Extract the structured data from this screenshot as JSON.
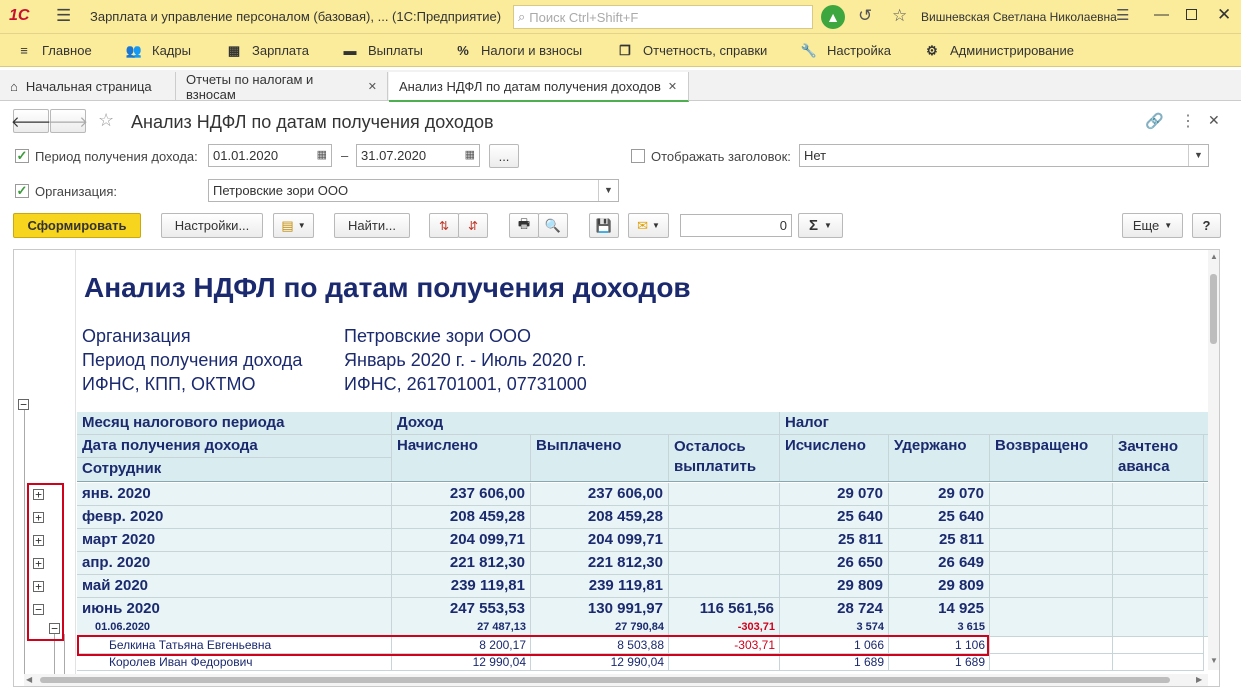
{
  "app": {
    "logo": "1С",
    "title": "Зарплата и управление персоналом (базовая), ...  (1С:Предприятие)",
    "search_placeholder": "Поиск Ctrl+Shift+F",
    "user": "Вишневская Светлана Николаевна"
  },
  "menu": [
    {
      "icon": "hamburger-icon",
      "label": "Главное"
    },
    {
      "icon": "people-icon",
      "label": "Кадры"
    },
    {
      "icon": "calculator-icon",
      "label": "Зарплата"
    },
    {
      "icon": "wallet-icon",
      "label": "Выплаты"
    },
    {
      "icon": "percent-icon",
      "label": "Налоги и взносы"
    },
    {
      "icon": "report-icon",
      "label": "Отчетность, справки"
    },
    {
      "icon": "wrench-icon",
      "label": "Настройка"
    },
    {
      "icon": "gear-icon",
      "label": "Администрирование"
    }
  ],
  "tabs": [
    {
      "label": "Начальная страница"
    },
    {
      "label": "Отчеты по налогам и взносам"
    },
    {
      "label": "Анализ НДФЛ по датам получения доходов"
    }
  ],
  "form": {
    "title": "Анализ НДФЛ по датам получения доходов",
    "period_label": "Период получения дохода:",
    "date_from": "01.01.2020",
    "date_dash": "–",
    "date_to": "31.07.2020",
    "ellipsis": "...",
    "show_header_label": "Отображать заголовок:",
    "show_header_value": "Нет",
    "org_label": "Организация:",
    "org_value": "Петровские зори ООО",
    "generate_btn": "Сформировать",
    "settings_btn": "Настройки...",
    "find_btn": "Найти...",
    "sum_value": "0",
    "sigma": "Σ",
    "more_btn": "Еще",
    "help_btn": "?"
  },
  "report": {
    "title": "Анализ НДФЛ по датам получения доходов",
    "meta": [
      {
        "label": "Организация",
        "value": "Петровские зори ООО"
      },
      {
        "label": "Период получения дохода",
        "value": "Январь 2020 г. - Июль 2020 г."
      },
      {
        "label": "ИФНС, КПП, ОКТМО",
        "value": "ИФНС, 261701001, 07731000"
      }
    ],
    "headers": {
      "h1": "Месяц налогового периода",
      "h2": "Дата получения дохода",
      "h3": "Сотрудник",
      "income": "Доход",
      "accrued": "Начислено",
      "paid": "Выплачено",
      "remaining": "Осталось выплатить",
      "tax": "Налог",
      "calculated": "Исчислено",
      "withheld": "Удержано",
      "returned": "Возвращено",
      "offset": "Зачтено аванса"
    },
    "months": [
      {
        "name": "янв. 2020",
        "accrued": "237 606,00",
        "paid": "237 606,00",
        "remaining": "",
        "calc": "29 070",
        "withheld": "29 070"
      },
      {
        "name": "февр. 2020",
        "accrued": "208 459,28",
        "paid": "208 459,28",
        "remaining": "",
        "calc": "25 640",
        "withheld": "25 640"
      },
      {
        "name": "март 2020",
        "accrued": "204 099,71",
        "paid": "204 099,71",
        "remaining": "",
        "calc": "25 811",
        "withheld": "25 811"
      },
      {
        "name": "апр. 2020",
        "accrued": "221 812,30",
        "paid": "221 812,30",
        "remaining": "",
        "calc": "26 650",
        "withheld": "26 649"
      },
      {
        "name": "май 2020",
        "accrued": "239 119,81",
        "paid": "239 119,81",
        "remaining": "",
        "calc": "29 809",
        "withheld": "29 809"
      },
      {
        "name": "июнь 2020",
        "accrued": "247 553,53",
        "paid": "130 991,97",
        "remaining": "116 561,56",
        "calc": "28 724",
        "withheld": "14 925"
      }
    ],
    "date_row": {
      "name": "01.06.2020",
      "accrued": "27 487,13",
      "paid": "27 790,84",
      "remaining": "-303,71",
      "calc": "3 574",
      "withheld": "3 615"
    },
    "employees": [
      {
        "name": "Белкина Татьяна Евгеньевна",
        "accrued": "8 200,17",
        "paid": "8 503,88",
        "remaining": "-303,71",
        "calc": "1 066",
        "withheld": "1 106"
      },
      {
        "name": "Королев Иван Федорович",
        "accrued": "12 990,04",
        "paid": "12 990,04",
        "remaining": "",
        "calc": "1 689",
        "withheld": "1 689"
      }
    ]
  },
  "colors": {
    "header_bg": "#fbec9c",
    "accent_green": "#4caf50",
    "primary_button": "#f7d51f",
    "report_text": "#1b2a6e",
    "table_header_bg": "#d9ecef",
    "table_row_bg": "#e9f4f6",
    "negative": "#d0021b",
    "highlight_frame": "#d0021b"
  }
}
